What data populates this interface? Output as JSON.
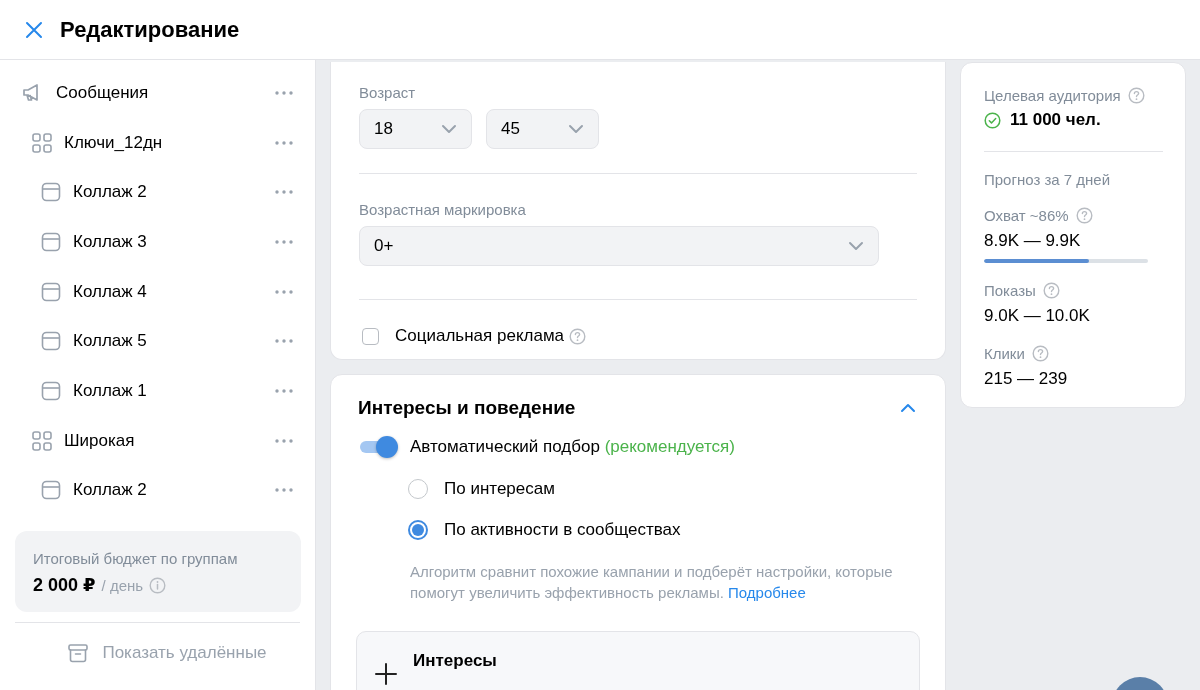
{
  "header": {
    "title": "Редактирование"
  },
  "sidebar": {
    "items": [
      {
        "kind": "campaign",
        "label": "Сообщения",
        "children": [
          {
            "kind": "group",
            "label": "Ключи_12дн",
            "children": [
              {
                "kind": "ad",
                "label": "Коллаж 2"
              },
              {
                "kind": "ad",
                "label": "Коллаж 3"
              },
              {
                "kind": "ad",
                "label": "Коллаж 4"
              },
              {
                "kind": "ad",
                "label": "Коллаж 5"
              },
              {
                "kind": "ad",
                "label": "Коллаж 1"
              }
            ]
          },
          {
            "kind": "group",
            "label": "Широкая",
            "children": [
              {
                "kind": "ad",
                "label": "Коллаж 2"
              }
            ]
          }
        ]
      }
    ],
    "budget": {
      "label": "Итоговый бюджет по группам",
      "amount": "2 000 ₽",
      "unit": "/ день"
    },
    "show_deleted": "Показать удалённые"
  },
  "audience_card": {
    "age_label": "Возраст",
    "age_from": "18",
    "age_to": "45",
    "rating_label": "Возрастная маркировка",
    "rating": "0+",
    "social_ad": {
      "label": "Социальная реклама",
      "checked": false
    }
  },
  "interests_card": {
    "title": "Интересы и поведение",
    "expanded": true,
    "auto": {
      "label": "Автоматический подбор",
      "note": "(рекомендуется)",
      "on": true
    },
    "options": [
      {
        "label": "По интересам",
        "selected": false
      },
      {
        "label": "По активности в сообществах",
        "selected": true
      }
    ],
    "description": "Алгоритм сравнит похожие кампании и подберёт настройки, которые помогут увеличить эффективность рекламы.",
    "link": "Подробнее",
    "interests_box": {
      "title": "Интересы"
    }
  },
  "forecast": {
    "audience_label": "Целевая аудитория",
    "audience_value": "11 000 чел.",
    "period": "Прогноз за 7 дней",
    "metrics": [
      {
        "label": "Охват ~86%",
        "value": "8.9K — 9.9K",
        "level": 0.64
      },
      {
        "label": "Показы",
        "value": "9.0K — 10.0K"
      },
      {
        "label": "Клики",
        "value": "215 — 239"
      }
    ]
  }
}
